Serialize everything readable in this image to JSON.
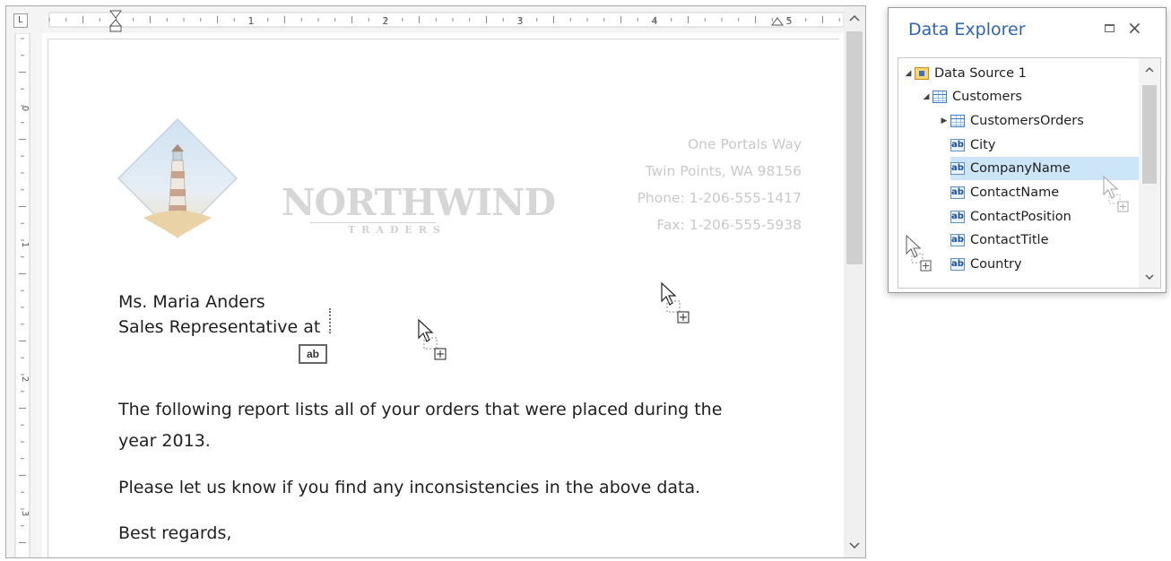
{
  "editor": {
    "ruler_numbers": [
      "1",
      "2",
      "3",
      "4",
      "5"
    ],
    "vruler_numbers": [
      "0",
      "1",
      "2",
      "3"
    ],
    "letterhead": {
      "company_name": "NORTHWIND",
      "company_sub": "TRADERS",
      "address_lines": [
        "One Portals Way",
        "Twin Points, WA 98156",
        "Phone: 1-206-555-1417",
        "Fax: 1-206-555-5938"
      ]
    },
    "recipient_name": "Ms. Maria Anders",
    "recipient_title": "Sales Representative at",
    "field_tag": "ab",
    "body_line1": "The following report lists all of your orders that were placed during the",
    "body_line2": "year 2013.",
    "body_para2": "Please let us know if you find any inconsistencies in the above data.",
    "closing": "Best regards,"
  },
  "explorer": {
    "title": "Data Explorer",
    "items": [
      {
        "label": "Data Source 1",
        "icon": "database-icon",
        "expander": "expanded"
      },
      {
        "label": "Customers",
        "icon": "table-icon",
        "expander": "expanded"
      },
      {
        "label": "CustomersOrders",
        "icon": "table-icon",
        "expander": "collapsed"
      },
      {
        "label": "City",
        "icon": "field-icon",
        "expander": ""
      },
      {
        "label": "CompanyName",
        "icon": "field-icon",
        "expander": "",
        "selected": true
      },
      {
        "label": "ContactName",
        "icon": "field-icon",
        "expander": ""
      },
      {
        "label": "ContactPosition",
        "icon": "field-icon",
        "expander": ""
      },
      {
        "label": "ContactTitle",
        "icon": "field-icon",
        "expander": ""
      },
      {
        "label": "Country",
        "icon": "field-icon",
        "expander": ""
      }
    ],
    "field_icon_text": "ab"
  },
  "colors": {
    "accent": "#2e64b8",
    "selection": "#cde6f7",
    "letterhead_gray": "#c9c9c9"
  }
}
